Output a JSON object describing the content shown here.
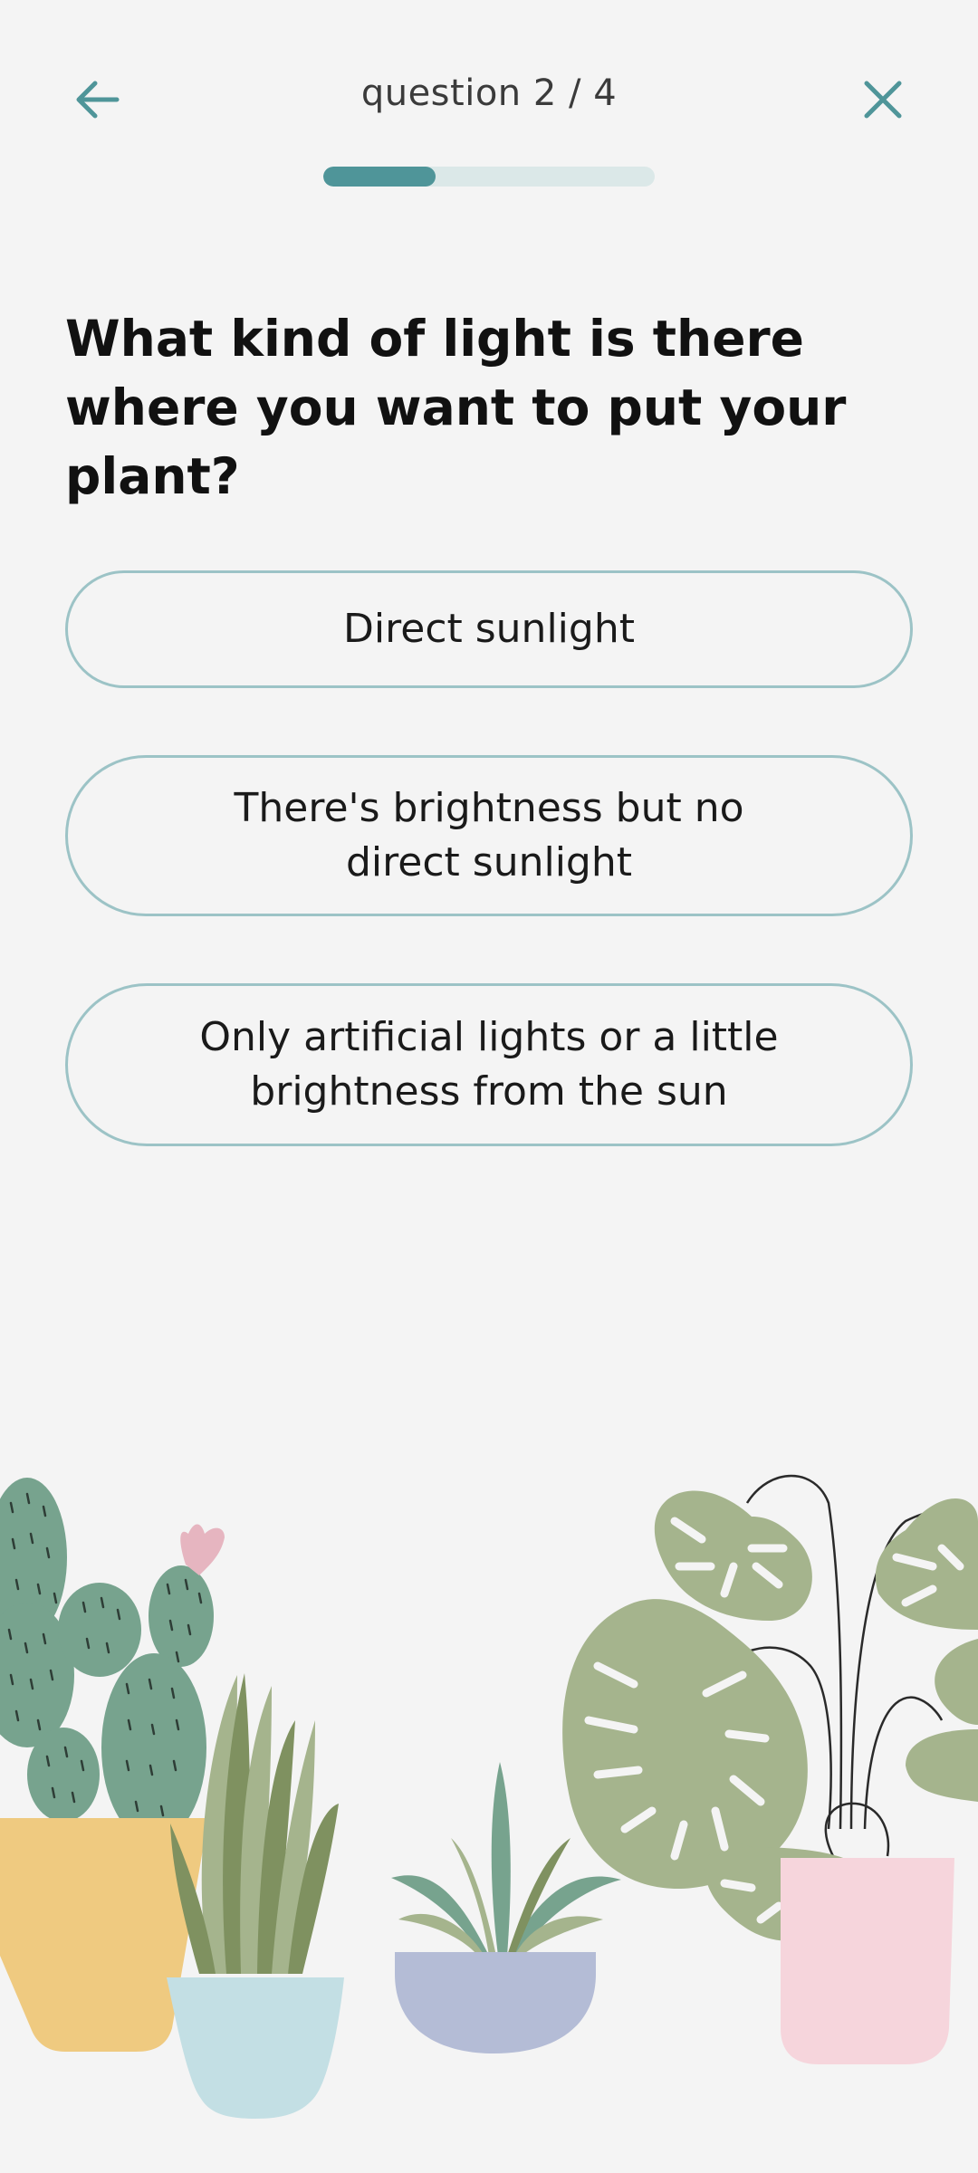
{
  "header": {
    "counter_text": "question 2 / 4",
    "back_icon": "arrow-left-icon",
    "close_icon": "close-icon",
    "progress_value": 0.34,
    "accent_color": "#4f9599",
    "track_color": "#dbe8e8"
  },
  "question": {
    "text": "What kind of light is there where you want to put your plant?"
  },
  "options": [
    {
      "label": "Direct sunlight"
    },
    {
      "label": "There's brightness but no direct sunlight"
    },
    {
      "label": "Only artificial lights or a little brightness from the sun"
    }
  ],
  "illustration": {
    "name": "houseplants-illustration",
    "pot_colors": [
      "#efca80",
      "#c3dfe4",
      "#b4bcd6",
      "#f6d5dc"
    ],
    "leaf_colors": [
      "#77a38e",
      "#a5b48d",
      "#7f9160"
    ]
  }
}
